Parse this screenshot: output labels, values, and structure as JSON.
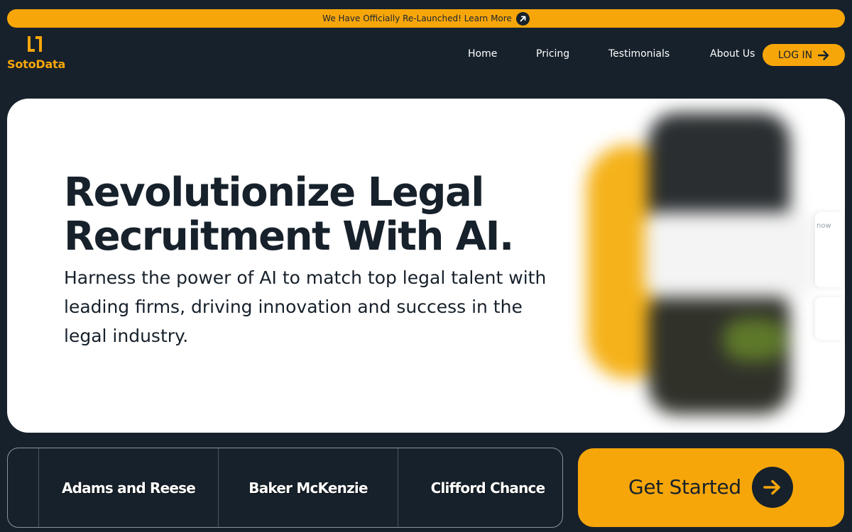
{
  "announcement": {
    "text": "We Have Officially Re-Launched! Learn More",
    "icon": "arrow-up-right-icon"
  },
  "brand": {
    "name": "SotoData",
    "logo_icon": "sotodata-logo-icon",
    "accent_color": "#f7a60a",
    "background_color": "#17212b"
  },
  "nav": {
    "items": [
      {
        "label": "Home"
      },
      {
        "label": "Pricing"
      },
      {
        "label": "Testimonials"
      },
      {
        "label": "About Us"
      }
    ],
    "login_label": "LOG IN",
    "login_icon": "arrow-right-icon"
  },
  "hero": {
    "title": "Revolutionize Legal Recruitment With AI.",
    "subtitle": "Harness the power of AI to match top legal talent with leading firms, driving innovation and success in the legal industry.",
    "notification_time": "now"
  },
  "clients": [
    {
      "name": "Adams and Reese"
    },
    {
      "name": "Baker McKenzie"
    },
    {
      "name": "Clifford Chance"
    }
  ],
  "cta": {
    "label": "Get Started",
    "icon": "arrow-right-icon"
  }
}
